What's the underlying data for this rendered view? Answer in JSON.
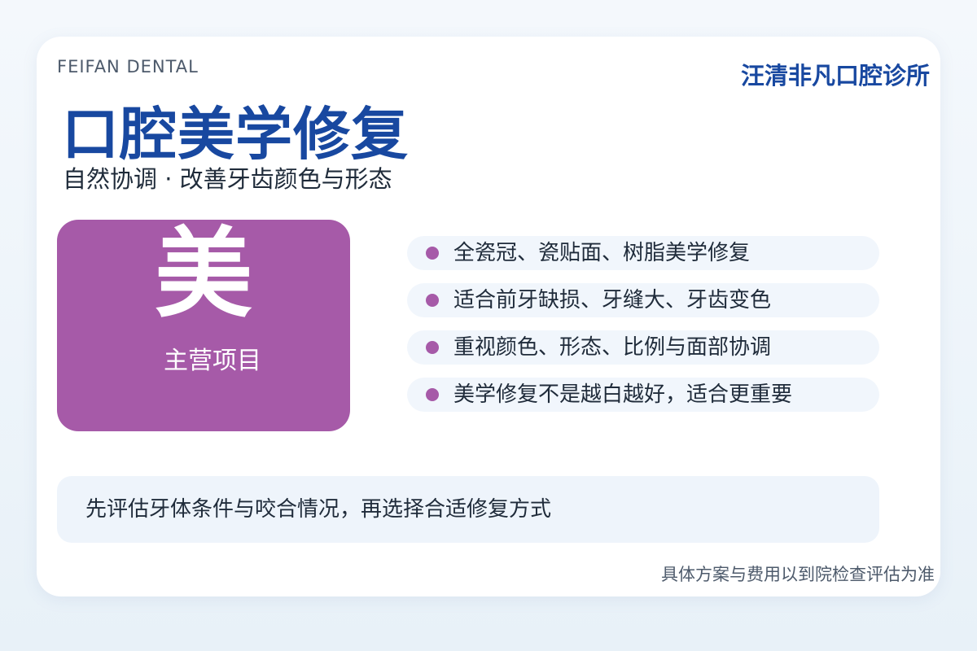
{
  "header": {
    "brand_en": "FEIFAN DENTAL",
    "clinic_name": "汪清非凡口腔诊所"
  },
  "hero": {
    "title": "口腔美学修复",
    "subtitle": "自然协调 · 改善牙齿颜色与形态"
  },
  "feature": {
    "char": "美",
    "label": "主营项目",
    "color": "#a65aa8"
  },
  "bullets": [
    {
      "text": "全瓷冠、瓷贴面、树脂美学修复"
    },
    {
      "text": "适合前牙缺损、牙缝大、牙齿变色"
    },
    {
      "text": "重视颜色、形态、比例与面部协调"
    },
    {
      "text": "美学修复不是越白越好，适合更重要"
    }
  ],
  "note": {
    "text": "先评估牙体条件与咬合情况，再选择合适修复方式"
  },
  "footer": {
    "text": "具体方案与费用以到院检查评估为准"
  },
  "colors": {
    "brand_blue": "#1848a0",
    "accent_purple": "#a65aa8",
    "text_dark": "#1f2b3a"
  }
}
